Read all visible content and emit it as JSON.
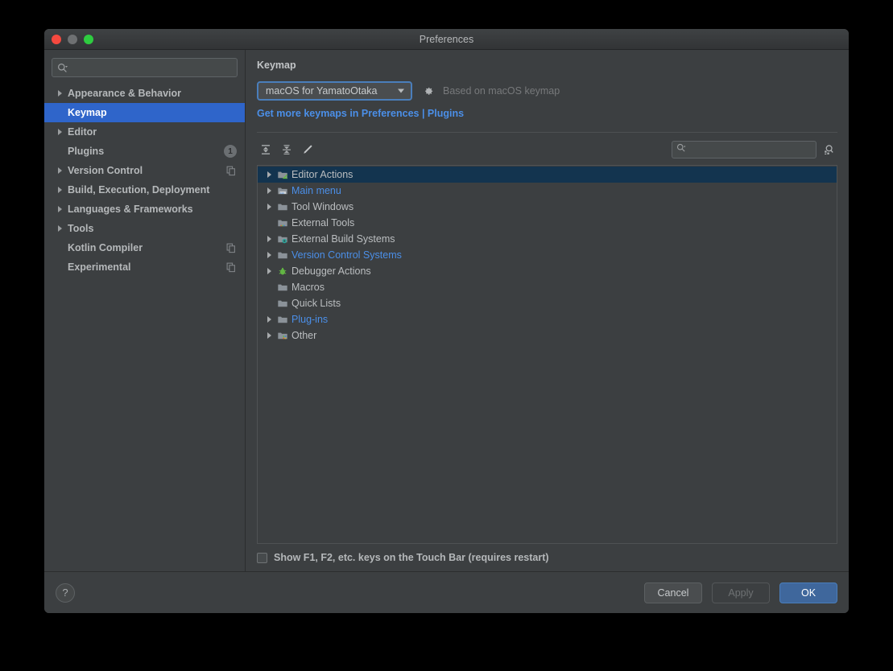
{
  "window": {
    "title": "Preferences",
    "traffic_lights": [
      "close-red",
      "minimize-gray",
      "maximize-green"
    ]
  },
  "sidebar": {
    "search": {
      "value": "",
      "placeholder": ""
    },
    "items": [
      {
        "label": "Appearance & Behavior",
        "expandable": true,
        "selected": false,
        "badge": "",
        "secondary_icon": ""
      },
      {
        "label": "Keymap",
        "expandable": false,
        "selected": true,
        "badge": "",
        "secondary_icon": ""
      },
      {
        "label": "Editor",
        "expandable": true,
        "selected": false,
        "badge": "",
        "secondary_icon": ""
      },
      {
        "label": "Plugins",
        "expandable": false,
        "selected": false,
        "badge": "1",
        "secondary_icon": ""
      },
      {
        "label": "Version Control",
        "expandable": true,
        "selected": false,
        "badge": "",
        "secondary_icon": "copy-icon"
      },
      {
        "label": "Build, Execution, Deployment",
        "expandable": true,
        "selected": false,
        "badge": "",
        "secondary_icon": ""
      },
      {
        "label": "Languages & Frameworks",
        "expandable": true,
        "selected": false,
        "badge": "",
        "secondary_icon": ""
      },
      {
        "label": "Tools",
        "expandable": true,
        "selected": false,
        "badge": "",
        "secondary_icon": ""
      },
      {
        "label": "Kotlin Compiler",
        "expandable": false,
        "selected": false,
        "badge": "",
        "secondary_icon": "copy-icon"
      },
      {
        "label": "Experimental",
        "expandable": false,
        "selected": false,
        "badge": "",
        "secondary_icon": "copy-icon"
      }
    ]
  },
  "content": {
    "title": "Keymap",
    "keymap_combo": {
      "value": "macOS for YamatoOtaka"
    },
    "gear_icon": "gear-icon",
    "based_on": "Based on macOS keymap",
    "plugins_link": "Get more keymaps in Preferences | Plugins",
    "toolbar": {
      "expand_all": "expand-all-icon",
      "collapse_all": "collapse-all-icon",
      "edit": "pencil-icon",
      "search": {
        "value": "",
        "placeholder": ""
      },
      "find_by_shortcut": "find-by-shortcut-icon"
    },
    "tree": [
      {
        "label": "Editor Actions",
        "expandable": true,
        "selected": true,
        "link": false,
        "icon": "editor-actions-icon"
      },
      {
        "label": "Main menu",
        "expandable": true,
        "selected": false,
        "link": true,
        "icon": "main-menu-icon"
      },
      {
        "label": "Tool Windows",
        "expandable": true,
        "selected": false,
        "link": false,
        "icon": "folder-icon"
      },
      {
        "label": "External Tools",
        "expandable": false,
        "selected": false,
        "link": false,
        "icon": "external-tools-icon"
      },
      {
        "label": "External Build Systems",
        "expandable": true,
        "selected": false,
        "link": false,
        "icon": "build-systems-icon"
      },
      {
        "label": "Version Control Systems",
        "expandable": true,
        "selected": false,
        "link": true,
        "icon": "folder-icon"
      },
      {
        "label": "Debugger Actions",
        "expandable": true,
        "selected": false,
        "link": false,
        "icon": "bug-icon"
      },
      {
        "label": "Macros",
        "expandable": false,
        "selected": false,
        "link": false,
        "icon": "folder-icon"
      },
      {
        "label": "Quick Lists",
        "expandable": false,
        "selected": false,
        "link": false,
        "icon": "folder-icon"
      },
      {
        "label": "Plug-ins",
        "expandable": true,
        "selected": false,
        "link": true,
        "icon": "folder-icon"
      },
      {
        "label": "Other",
        "expandable": true,
        "selected": false,
        "link": false,
        "icon": "other-icon"
      }
    ],
    "touchbar": {
      "checked": false,
      "label": "Show F1, F2, etc. keys on the Touch Bar (requires restart)"
    }
  },
  "footer": {
    "help": "?",
    "cancel": "Cancel",
    "apply": "Apply",
    "ok": "OK"
  },
  "colors": {
    "window_bg": "#3c3f41",
    "sidebar_selection": "#2f65ca",
    "tree_selection": "#13344f",
    "link": "#4b8fe8",
    "primary_button": "#3f679c",
    "focus_border": "#4a7ebb"
  }
}
